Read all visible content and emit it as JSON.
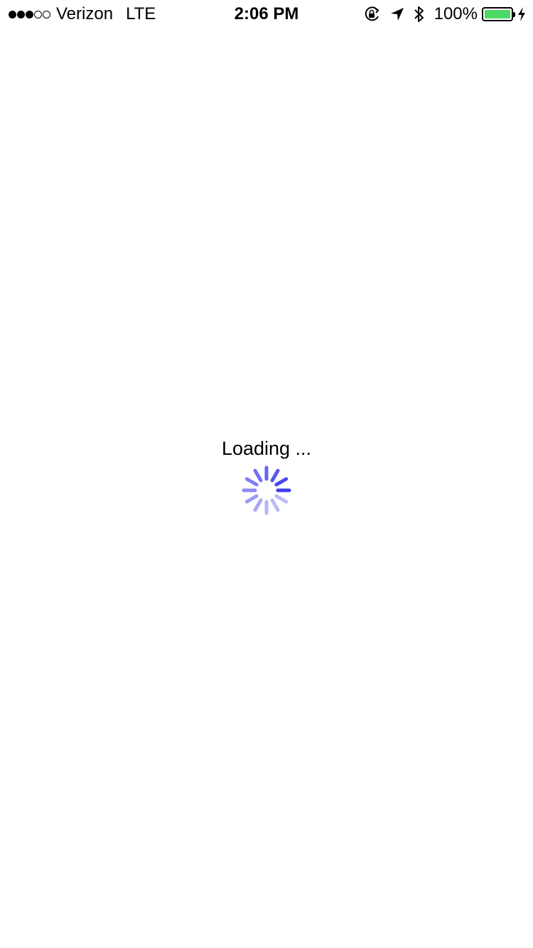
{
  "status_bar": {
    "signal_bars": 5,
    "signal_filled": 3,
    "carrier": "Verizon",
    "network": "LTE",
    "time": "2:06 PM",
    "icons": [
      "rotation-lock-icon",
      "location-arrow-icon",
      "bluetooth-icon"
    ],
    "battery_percent": "100%",
    "battery_level": 1.0,
    "battery_color": "#4cd964",
    "charging": true
  },
  "loading": {
    "text": "Loading ...",
    "spinner_color": "#3b3bf0",
    "spinner_segments": 12
  }
}
